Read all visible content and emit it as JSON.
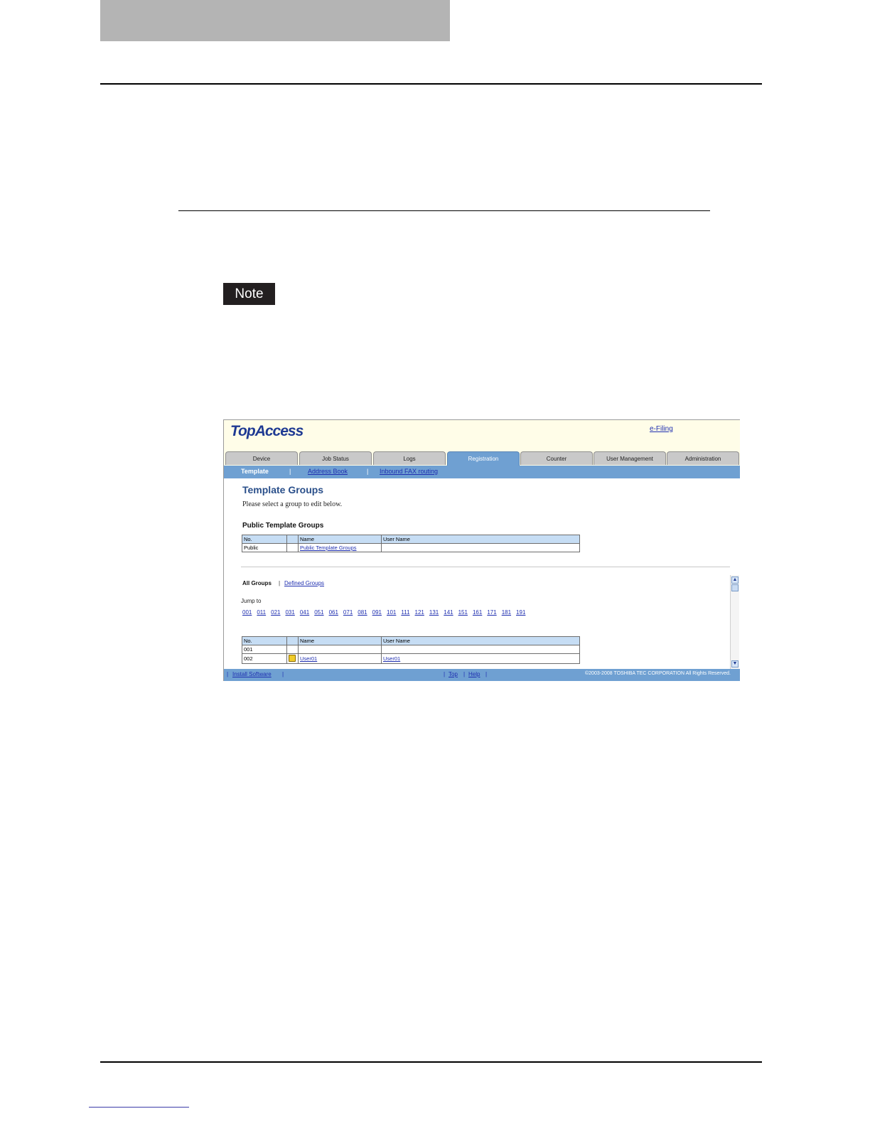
{
  "page": {
    "note_label": "Note"
  },
  "screenshot": {
    "logo": "TopAccess",
    "top_link": "e-Filing",
    "tabs": [
      "Device",
      "Job Status",
      "Logs",
      "Registration",
      "Counter",
      "User Management",
      "Administration"
    ],
    "active_tab": "Registration",
    "subnav": {
      "current": "Template",
      "sep": "|",
      "links": [
        "Address Book",
        "Inbound FAX routing"
      ]
    },
    "title": "Template Groups",
    "instruction": "Please select a group to edit below.",
    "public_section_title": "Public Template Groups",
    "public_table": {
      "headers": [
        "No.",
        "",
        "Name",
        "User Name"
      ],
      "rows": [
        [
          "Public",
          "",
          "Public Template Groups",
          ""
        ]
      ]
    },
    "group_filter": {
      "all": "All Groups",
      "sep": "|",
      "defined": "Defined Groups"
    },
    "jump_label": "Jump to",
    "jump_numbers": [
      "001",
      "011",
      "021",
      "031",
      "041",
      "051",
      "061",
      "071",
      "081",
      "091",
      "101",
      "111",
      "121",
      "131",
      "141",
      "151",
      "161",
      "171",
      "181",
      "191"
    ],
    "groups_table": {
      "headers": [
        "No.",
        "",
        "Name",
        "User Name"
      ],
      "rows": [
        [
          "001",
          "",
          "",
          ""
        ],
        [
          "002",
          "lock-icon",
          "User01",
          "User01"
        ]
      ]
    },
    "footer": {
      "install": "Install Software",
      "top": "Top",
      "help": "Help",
      "sep": "|",
      "copyright": "©2003-2008 TOSHIBA TEC CORPORATION All Rights Reserved."
    }
  }
}
